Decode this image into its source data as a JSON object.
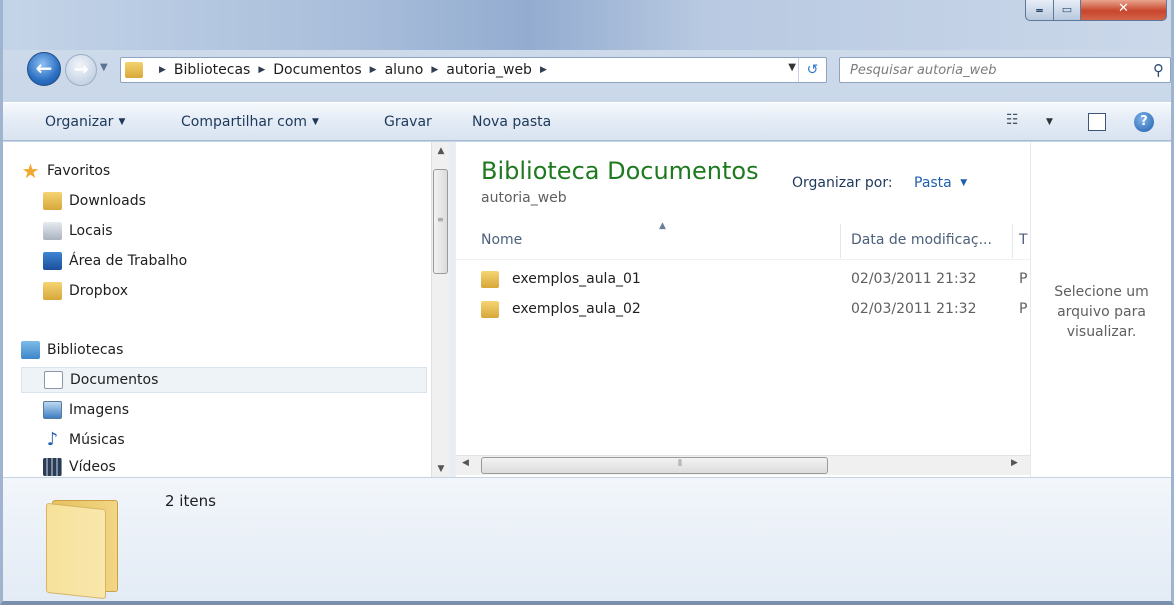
{
  "address": {
    "crumbs": [
      "Bibliotecas",
      "Documentos",
      "aluno",
      "autoria_web"
    ]
  },
  "search": {
    "placeholder": "Pesquisar autoria_web"
  },
  "toolbar": {
    "organize": "Organizar",
    "share": "Compartilhar com",
    "burn": "Gravar",
    "new_folder": "Nova pasta"
  },
  "nav": {
    "favorites": "Favoritos",
    "downloads": "Downloads",
    "places": "Locais",
    "desktop": "Área de Trabalho",
    "dropbox": "Dropbox",
    "libraries": "Bibliotecas",
    "documents": "Documentos",
    "images": "Imagens",
    "music": "Músicas",
    "videos": "Vídeos"
  },
  "library": {
    "title": "Biblioteca Documentos",
    "subtitle": "autoria_web",
    "arrange_label": "Organizar por:",
    "arrange_value": "Pasta"
  },
  "columns": {
    "name": "Nome",
    "date": "Data de modificaç...",
    "type": "T"
  },
  "files": [
    {
      "name": "exemplos_aula_01",
      "date": "02/03/2011 21:32",
      "type": "P"
    },
    {
      "name": "exemplos_aula_02",
      "date": "02/03/2011 21:32",
      "type": "P"
    }
  ],
  "preview": {
    "message": "Selecione um arquivo para visualizar."
  },
  "details": {
    "count": "2 itens"
  },
  "colors": {
    "library_title": "#1f7a1f",
    "link": "#1f5fae",
    "close_button": "#c7462c"
  },
  "icons": {
    "back": "back-arrow-icon",
    "forward": "forward-arrow-icon",
    "search": "magnifier-icon",
    "help": "help-icon",
    "favorites": "star-icon",
    "folder": "folder-icon"
  }
}
